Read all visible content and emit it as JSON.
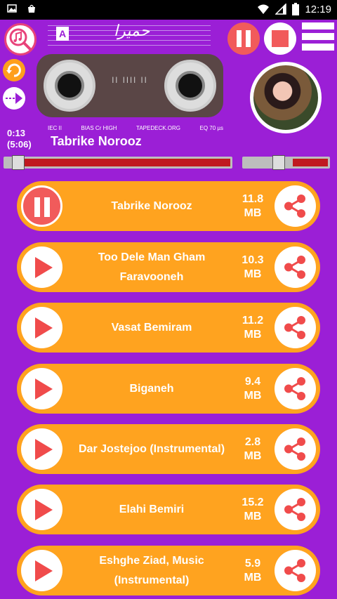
{
  "status": {
    "time": "12:19"
  },
  "header": {
    "cassette_side": "A",
    "cassette_signature": "حمیرا"
  },
  "cassette_specs": [
    "IEC II",
    "BIAS Cr HIGH",
    "TAPEDECK.ORG",
    "EQ 70 µs"
  ],
  "player": {
    "elapsed": "0:13",
    "duration": "(5:06)",
    "now_playing": "Tabrike Norooz",
    "progress": 0.04,
    "volume": 0.4
  },
  "colors": {
    "background": "#9b1fd6",
    "row": "#ffa31f",
    "accent": "#f04b4b"
  },
  "tracks": [
    {
      "title": "Tabrike Norooz",
      "size": "11.8",
      "unit": "MB",
      "state": "playing"
    },
    {
      "title": "Too Dele Man Gham Faravooneh",
      "size": "10.3",
      "unit": "MB",
      "state": "stopped"
    },
    {
      "title": "Vasat Bemiram",
      "size": "11.2",
      "unit": "MB",
      "state": "stopped"
    },
    {
      "title": "Biganeh",
      "size": "9.4",
      "unit": "MB",
      "state": "stopped"
    },
    {
      "title": "Dar Jostejoo (Instrumental)",
      "size": "2.8",
      "unit": "MB",
      "state": "stopped"
    },
    {
      "title": "Elahi Bemiri",
      "size": "15.2",
      "unit": "MB",
      "state": "stopped"
    },
    {
      "title": "Eshghe Ziad, Music (Instrumental)",
      "size": "5.9",
      "unit": "MB",
      "state": "stopped"
    }
  ]
}
